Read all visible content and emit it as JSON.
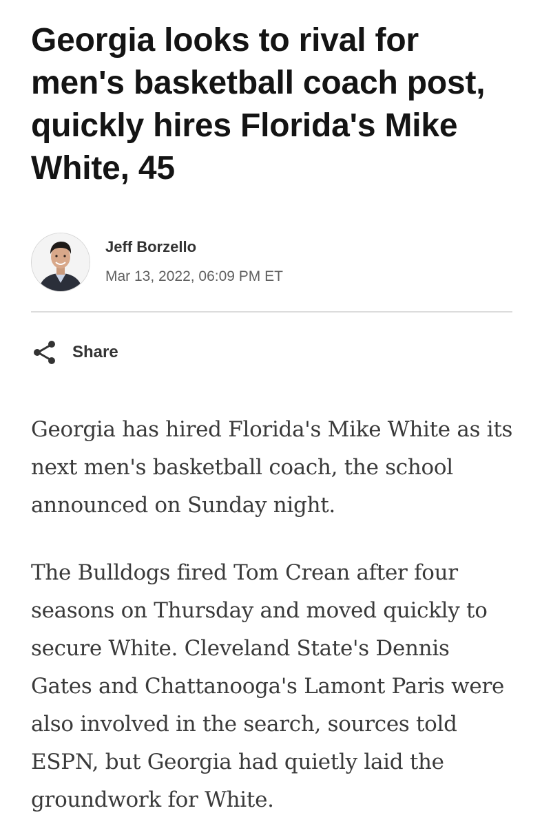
{
  "article": {
    "headline": "Georgia looks to rival for men's basketball coach post, quickly hires Florida's Mike White, 45",
    "author": {
      "name": "Jeff Borzello",
      "date": "Mar 13, 2022, 06:09 PM ET",
      "avatar_icon": "author-photo"
    },
    "share": {
      "label": "Share",
      "icon": "share-icon"
    },
    "paragraphs": [
      "Georgia has hired Florida's Mike White as its next men's basketball coach, the school announced on Sunday night.",
      "The Bulldogs fired Tom Crean after four seasons on Thursday and moved quickly to secure White. Cleveland State's Dennis Gates and Chattanooga's Lamont Paris were also involved in the search, sources told ESPN, but Georgia had quietly laid the groundwork for White."
    ]
  },
  "colors": {
    "headline": "#141414",
    "body_text": "#3a3a3a",
    "meta_text": "#5f5f5f",
    "divider": "#dcdcdc"
  }
}
